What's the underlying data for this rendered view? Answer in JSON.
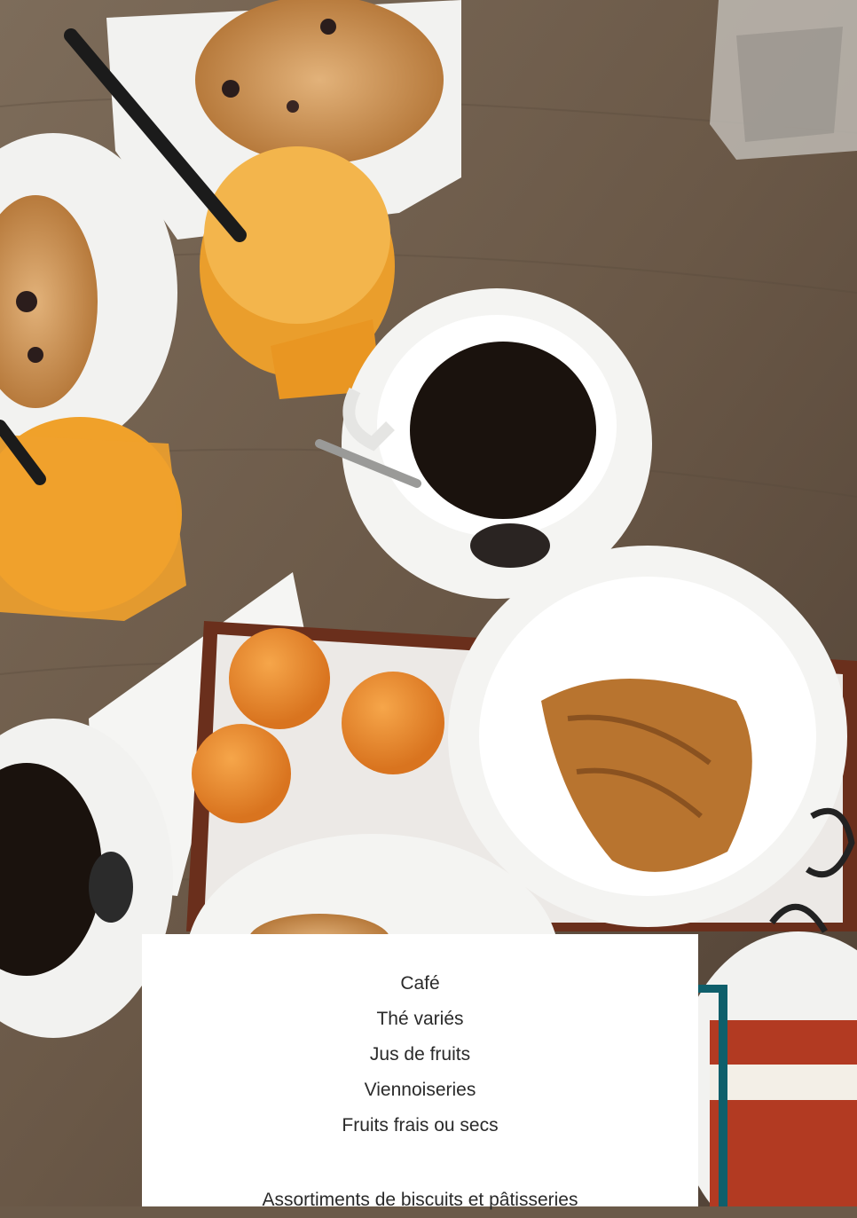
{
  "photo": {
    "description_icon": "breakfast-table-photo",
    "palette": {
      "table": "#6b5a49",
      "plate": "#f2f2f0",
      "coffee": "#1a120d",
      "juice": "#f0a12a",
      "orange": "#e88a2e",
      "tray": "#6a2f1c",
      "croissant": "#b8742f"
    }
  },
  "accent": {
    "color": "#0f5f6b"
  },
  "menu": {
    "items": [
      "Café",
      "Thé variés",
      "Jus de fruits",
      "Viennoiseries",
      "Fruits frais ou secs"
    ],
    "note": "Assortiments de biscuits et pâtisseries"
  }
}
